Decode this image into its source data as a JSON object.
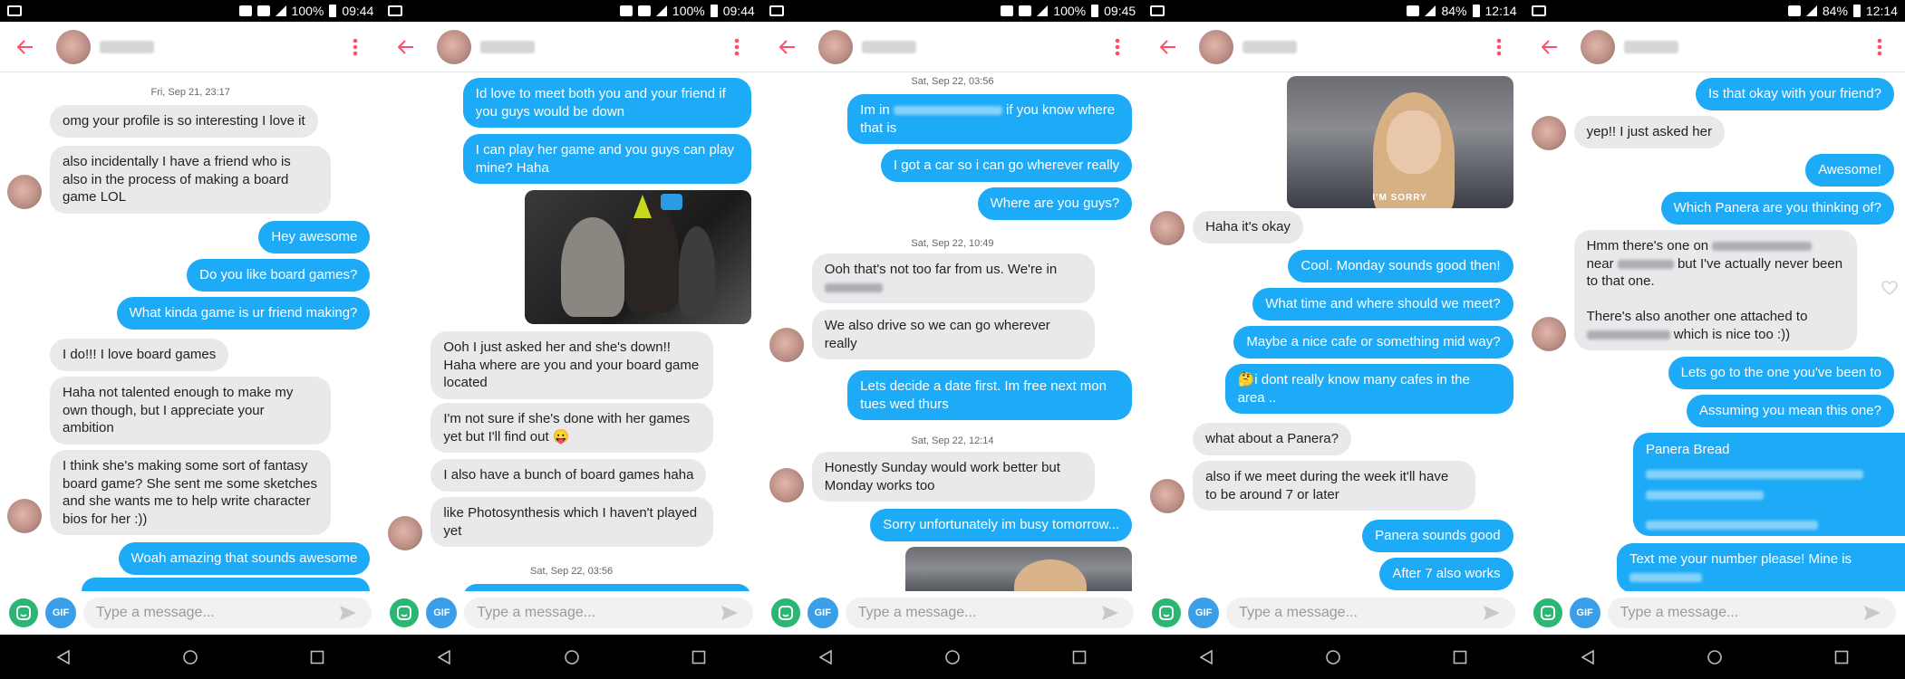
{
  "colors": {
    "accent": "#fd5068",
    "outgoing_bubble": "#1daaf7",
    "incoming_bubble": "#e9e9eb"
  },
  "composer": {
    "placeholder": "Type a message...",
    "gif_label": "GIF"
  },
  "panels": [
    {
      "status": {
        "battery": "100%",
        "time": "09:44"
      },
      "messages": {
        "ts1": "Fri, Sep 21, 23:17",
        "m1": "omg your profile is so interesting I love it",
        "m2": "also incidentally I have a friend who is also in the process of making a board game LOL",
        "m3": "Hey awesome",
        "m4": "Do you like board games?",
        "m5": "What kinda game is ur friend making?",
        "m6": "I do!!! I love board games",
        "m7": "Haha not talented enough to make my own though, but I appreciate your ambition",
        "m8": "I think she's making some sort of fantasy board game? She sent me some sketches and she wants me to help write character bios for her :))",
        "m9": "Woah amazing that sounds awesome"
      }
    },
    {
      "status": {
        "battery": "100%",
        "time": "09:44"
      },
      "messages": {
        "m1": "Id love to meet both you and your friend if you guys would be down",
        "m2": "I can play her game and you guys can play mine? Haha",
        "m3": "Ooh I just asked her and she's down!! Haha where are you and your board game located",
        "m4": "I'm not sure if she's done with her games yet but I'll find out 😛",
        "m5": "I also have a bunch of board games haha",
        "m6": "like Photosynthesis which I haven't played yet",
        "ts1": "Sat, Sep 22, 03:56"
      }
    },
    {
      "status": {
        "battery": "100%",
        "time": "09:45"
      },
      "messages": {
        "ts1": "Sat, Sep 22, 03:56",
        "m1a": "Im in",
        "m1b": "if you know where that is",
        "m2": "I got a car so i can go wherever really",
        "m3": "Where are you guys?",
        "ts2": "Sat, Sep 22, 10:49",
        "m4": "Ooh that's not too far from us. We're in",
        "m5": "We also drive so we can go wherever really",
        "m6": "Lets decide a date first. Im free next mon tues wed thurs",
        "ts3": "Sat, Sep 22, 12:14",
        "m7": "Honestly Sunday would work better but Monday works too",
        "m8": "Sorry unfortunately im busy tomorrow..."
      }
    },
    {
      "status": {
        "battery": "84%",
        "time": "12:14"
      },
      "messages": {
        "img_caption": "I'M SORRY",
        "m1": "Haha it's okay",
        "m2": "Cool. Monday sounds good then!",
        "m3": "What time and where should we meet?",
        "m4": "Maybe a nice cafe or something mid way?",
        "m5": "🤔i dont really know many cafes in the area ..",
        "m6": "what about a Panera?",
        "m7": "also if we meet during the week it'll have to be around 7 or later",
        "m8": "Panera sounds good",
        "m9": "After 7 also works"
      }
    },
    {
      "status": {
        "battery": "84%",
        "time": "12:14"
      },
      "messages": {
        "m1": "Is that okay with your friend?",
        "m2": "yep!! I just asked her",
        "m3": "Awesome!",
        "m4": "Which Panera are you thinking of?",
        "m5a": "Hmm there's one on",
        "m5b": "near",
        "m5c": "but I've actually never been to that one.",
        "m5d": "There's also another one attached to",
        "m5e": "which is nice too :))",
        "m6": "Lets go to the one you've been to",
        "m7": "Assuming you mean this one?",
        "m8": "Panera Bread",
        "m9": "Text me your number please! Mine is"
      }
    }
  ]
}
